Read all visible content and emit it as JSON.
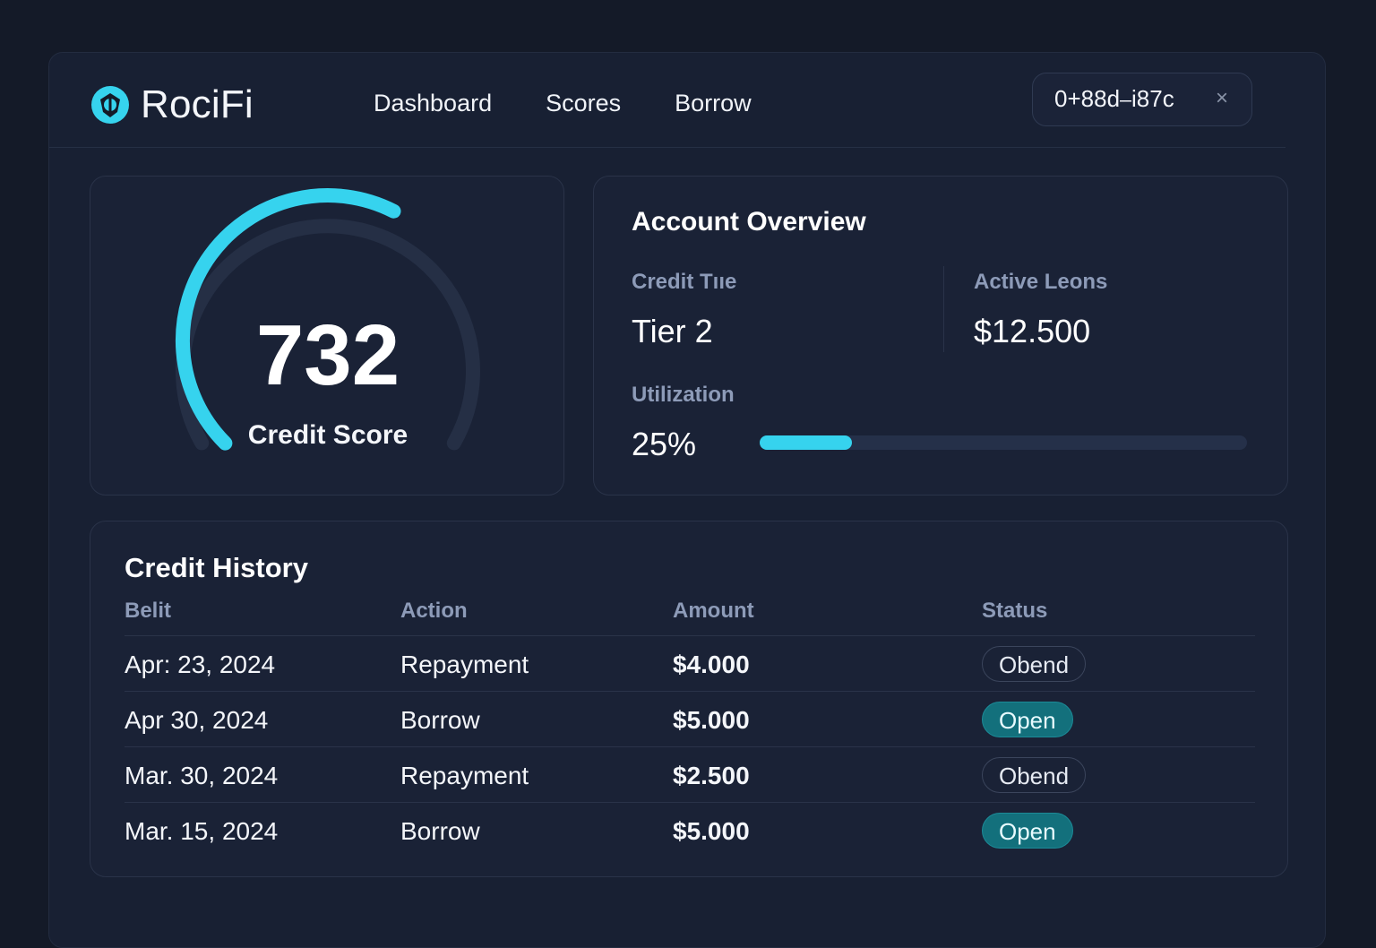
{
  "brand": {
    "name": "RociFi"
  },
  "nav": {
    "items": [
      "Dashboard",
      "Scores",
      "Borrow"
    ]
  },
  "wallet": {
    "address": "0+88d⎯i87c",
    "close_glyph": "×"
  },
  "colors": {
    "accent": "#36d3ee",
    "open_badge": "#13707c",
    "background": "#141a28",
    "card": "#1a2236"
  },
  "score": {
    "value": "732",
    "label": "Credit Score",
    "gauge_fraction": 0.6
  },
  "overview": {
    "title": "Account Overview",
    "credit_tier_label": "Credit Tııe",
    "credit_tier_value": "Tier 2",
    "active_loans_label": "Active Leons",
    "active_loans_value": "$12.500",
    "utilization_label": "Utilization",
    "utilization_value": "25%",
    "utilization_fraction": 0.19
  },
  "history": {
    "title": "Credit History",
    "columns": [
      "Belit",
      "Action",
      "Amount",
      "Status"
    ],
    "rows": [
      {
        "date": "Apr: 23, 2024",
        "action": "Repayment",
        "amount": "$4.000",
        "status": "Obend",
        "status_kind": "closed"
      },
      {
        "date": "Apr 30, 2024",
        "action": "Borrow",
        "amount": "$5.000",
        "status": "Open",
        "status_kind": "open"
      },
      {
        "date": "Mar. 30, 2024",
        "action": "Repayment",
        "amount": "$2.500",
        "status": "Obend",
        "status_kind": "closed"
      },
      {
        "date": "Mar. 15, 2024",
        "action": "Borrow",
        "amount": "$5.000",
        "status": "Open",
        "status_kind": "open"
      }
    ]
  }
}
